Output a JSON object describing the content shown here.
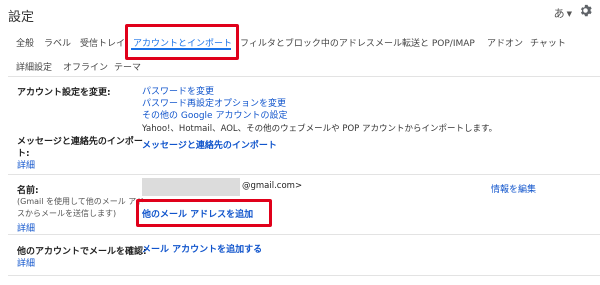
{
  "header": {
    "title": "設定",
    "lang_label": "あ"
  },
  "tabs": [
    {
      "label": "全般"
    },
    {
      "label": "ラベル"
    },
    {
      "label": "受信トレイ"
    },
    {
      "label": "アカウントとインポート",
      "active": true
    },
    {
      "label": "フィルタとブロック中のアドレス"
    },
    {
      "label": "メール転送と POP/IMAP"
    },
    {
      "label": "アドオン"
    },
    {
      "label": "チャット"
    },
    {
      "label": "詳細設定"
    },
    {
      "label": "オフライン"
    },
    {
      "label": "テーマ"
    }
  ],
  "sections": {
    "account_settings": {
      "label": "アカウント設定を変更:",
      "links": [
        "パスワードを変更",
        "パスワード再設定オプションを変更",
        "その他の Google アカウントの設定"
      ]
    },
    "import": {
      "label_line1": "メッセージと連絡先のインポー",
      "label_line2": "ト:",
      "details": "詳細",
      "description": "Yahoo!、Hotmail、AOL、その他のウェブメールや POP アカウントからインポートします。",
      "action": "メッセージと連絡先のインポート"
    },
    "send_as": {
      "label": "名前:",
      "note_line1": "(Gmail を使用して他のメール アド",
      "note_line2": "スからメールを送信します)",
      "details": "詳細",
      "email_suffix": "@gmail.com>",
      "edit": "情報を編集",
      "add_address": "他のメール アドレスを追加"
    },
    "check_mail": {
      "label": "他のアカウントでメールを確認:",
      "details": "詳細",
      "add_account": "メール アカウントを追加する"
    }
  },
  "colors": {
    "accent": "#1a73e8",
    "link": "#1155cc",
    "highlight": "#e0001a"
  }
}
